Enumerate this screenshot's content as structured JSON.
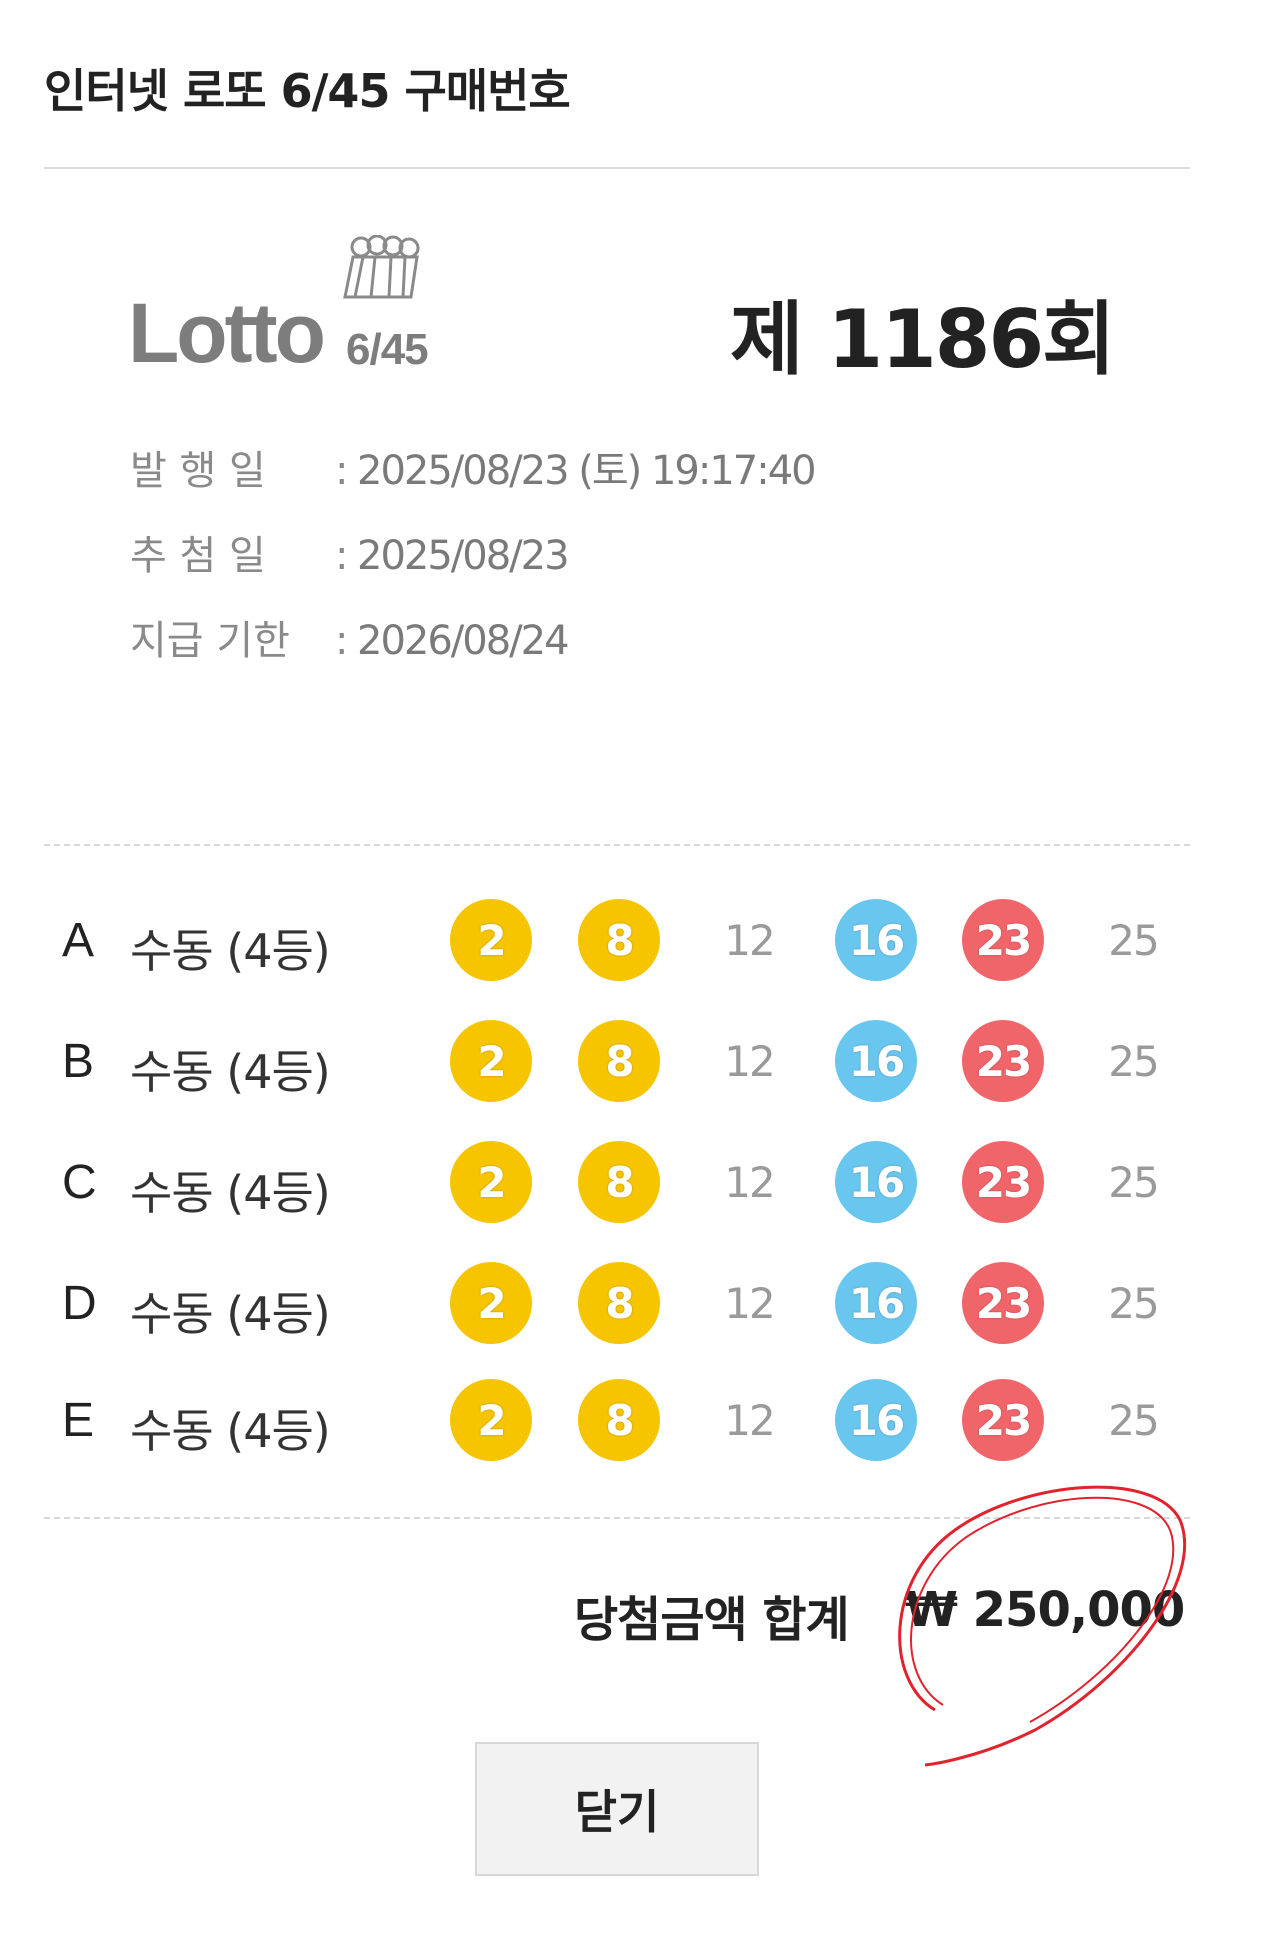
{
  "header": {
    "title": "인터넷 로또 6/45 구매번호"
  },
  "ticket": {
    "logo_text": "Lotto",
    "logo_sub": "6/45",
    "round": "제 1186회",
    "info": [
      {
        "label": "발 행 일",
        "value": "2025/08/23 (토) 19:17:40"
      },
      {
        "label": "추 첨 일",
        "value": "2025/08/23"
      },
      {
        "label": "지급 기한",
        "value": "2026/08/24"
      }
    ],
    "separator": ":"
  },
  "games": [
    {
      "letter": "A",
      "kind": "수동 (4등)",
      "numbers": [
        "2",
        "8",
        "12",
        "16",
        "23",
        "25"
      ]
    },
    {
      "letter": "B",
      "kind": "수동 (4등)",
      "numbers": [
        "2",
        "8",
        "12",
        "16",
        "23",
        "25"
      ]
    },
    {
      "letter": "C",
      "kind": "수동 (4등)",
      "numbers": [
        "2",
        "8",
        "12",
        "16",
        "23",
        "25"
      ]
    },
    {
      "letter": "D",
      "kind": "수동 (4등)",
      "numbers": [
        "2",
        "8",
        "12",
        "16",
        "23",
        "25"
      ]
    },
    {
      "letter": "E",
      "kind": "수동 (4등)",
      "numbers": [
        "2",
        "8",
        "12",
        "16",
        "23",
        "25"
      ]
    }
  ],
  "ball_styles": [
    "yellow",
    "yellow",
    "plain",
    "blue",
    "red",
    "plain"
  ],
  "colors": {
    "yellow": "#f7c400",
    "blue": "#69c6ef",
    "red": "#f0656a",
    "plain_text": "#9a9a9a",
    "circle_mark": "#e0232d"
  },
  "total": {
    "label": "당첨금액 합계",
    "value": "₩ 250,000"
  },
  "close_label": "닫기"
}
